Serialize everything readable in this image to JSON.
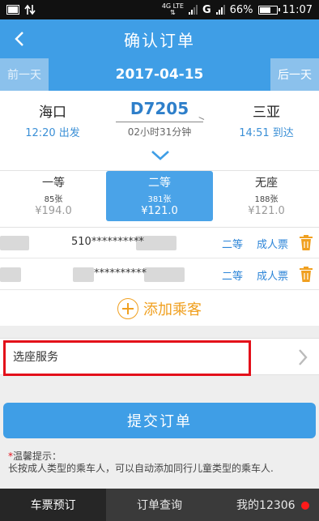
{
  "status_bar": {
    "network": "4G LTE",
    "carrier_label": "G",
    "battery": "66%",
    "time": "11:07"
  },
  "header": {
    "back": "<",
    "title": "确认订单"
  },
  "date_bar": {
    "prev_label": "前一天",
    "date": "2017-04-15",
    "next_label": "后一天"
  },
  "train": {
    "from_station": "海口",
    "depart": "12:20 出发",
    "number": "D7205",
    "duration": "02小时31分钟",
    "to_station": "三亚",
    "arrive": "14:51 到达"
  },
  "seats": [
    {
      "name": "一等",
      "count": "85张",
      "price": "¥194.0"
    },
    {
      "name": "二等",
      "count": "381张",
      "price": "¥121.0"
    },
    {
      "name": "无座",
      "count": "188张",
      "price": "¥121.0"
    }
  ],
  "selected_seat": "二等",
  "passengers": [
    {
      "id": "510**********",
      "seat": "二等",
      "type": "成人票"
    },
    {
      "id": "**********",
      "seat": "二等",
      "type": "成人票"
    }
  ],
  "add_passenger": "添加乘客",
  "seat_service": "选座服务",
  "submit": "提交订单",
  "tips": {
    "star": "*",
    "title": "温馨提示：",
    "text": "长按成人类型的乘车人，可以自动添加同行儿童类型的乘车人."
  },
  "tabs": [
    {
      "label": "车票预订"
    },
    {
      "label": "订单查询"
    },
    {
      "label": "我的12306"
    }
  ],
  "colors": {
    "primary": "#3f9ee6",
    "accent": "#f0a020",
    "highlight": "#e3101a"
  }
}
